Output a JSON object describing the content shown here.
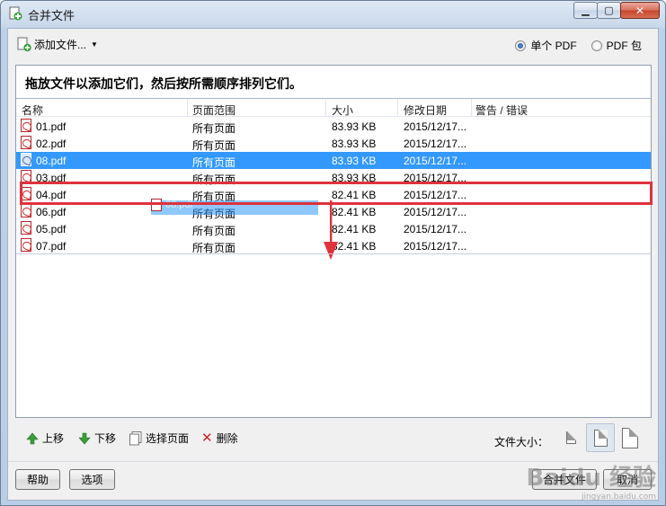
{
  "window": {
    "title": "合并文件"
  },
  "toolbar": {
    "add_files_label": "添加文件...",
    "radio_single": "单个 PDF",
    "radio_package": "PDF 包",
    "selected_mode": "单个 PDF"
  },
  "instruction": "拖放文件以添加它们，然后按所需顺序排列它们。",
  "table": {
    "columns": [
      "名称",
      "页面范围",
      "大小",
      "修改日期",
      "警告 / 错误"
    ],
    "rows": [
      {
        "name": "01.pdf",
        "range": "所有页面",
        "size": "83.93 KB",
        "date": "2015/12/17...",
        "warning": "",
        "selected": false
      },
      {
        "name": "02.pdf",
        "range": "所有页面",
        "size": "83.93 KB",
        "date": "2015/12/17...",
        "warning": "",
        "selected": false
      },
      {
        "name": "08.pdf",
        "range": "所有页面",
        "size": "83.93 KB",
        "date": "2015/12/17...",
        "warning": "",
        "selected": true
      },
      {
        "name": "03.pdf",
        "range": "所有页面",
        "size": "83.93 KB",
        "date": "2015/12/17...",
        "warning": "",
        "selected": false
      },
      {
        "name": "04.pdf",
        "range": "所有页面",
        "size": "82.41 KB",
        "date": "2015/12/17...",
        "warning": "",
        "selected": false
      },
      {
        "name": "06.pdf",
        "range": "所有页面",
        "size": "82.41 KB",
        "date": "2015/12/17...",
        "warning": "",
        "selected": false
      },
      {
        "name": "05.pdf",
        "range": "所有页面",
        "size": "82.41 KB",
        "date": "2015/12/17...",
        "warning": "",
        "selected": false
      },
      {
        "name": "07.pdf",
        "range": "所有页面",
        "size": "82.41 KB",
        "date": "2015/12/17...",
        "warning": "",
        "selected": false
      }
    ],
    "drag_ghost_label": "08.pdf"
  },
  "actions": {
    "move_up": "上移",
    "move_down": "下移",
    "choose_pages": "选择页面",
    "delete": "删除",
    "file_size_label": "文件大小："
  },
  "footer": {
    "help": "帮助",
    "options": "选项",
    "merge": "合并文件",
    "cancel": "取消"
  },
  "watermark": {
    "brand": "Baidu 经验",
    "url": "jingyan.baidu.com"
  },
  "colors": {
    "selection": "#3399ff",
    "highlight": "#e0323c",
    "arrow": "#e0323c"
  }
}
